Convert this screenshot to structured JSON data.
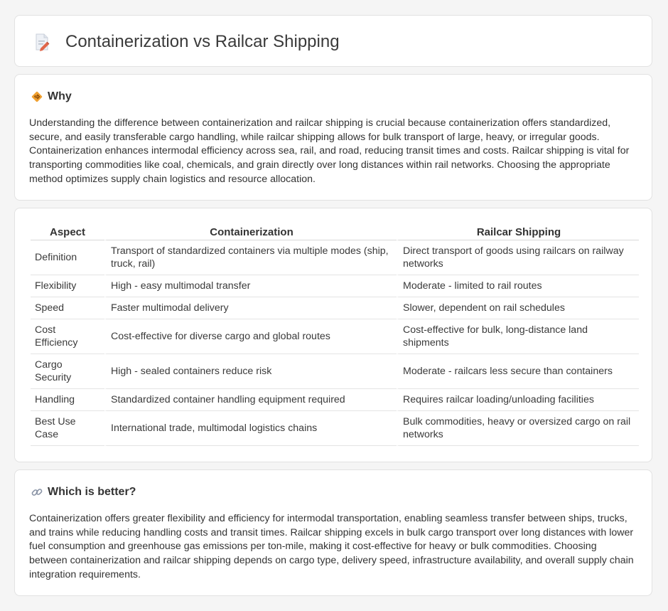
{
  "page": {
    "title": "Containerization vs Railcar Shipping",
    "title_icon": "document-pencil-icon"
  },
  "why": {
    "icon": "diamond-direction-icon",
    "heading": "Why",
    "text": "Understanding the difference between containerization and railcar shipping is crucial because containerization offers standardized, secure, and easily transferable cargo handling, while railcar shipping allows for bulk transport of large, heavy, or irregular goods. Containerization enhances intermodal efficiency across sea, rail, and road, reducing transit times and costs. Railcar shipping is vital for transporting commodities like coal, chemicals, and grain directly over long distances within rail networks. Choosing the appropriate method optimizes supply chain logistics and resource allocation."
  },
  "comparison": {
    "headers": [
      "Aspect",
      "Containerization",
      "Railcar Shipping"
    ],
    "rows": [
      [
        "Definition",
        "Transport of standardized containers via multiple modes (ship, truck, rail)",
        "Direct transport of goods using railcars on railway networks"
      ],
      [
        "Flexibility",
        "High - easy multimodal transfer",
        "Moderate - limited to rail routes"
      ],
      [
        "Speed",
        "Faster multimodal delivery",
        "Slower, dependent on rail schedules"
      ],
      [
        "Cost Efficiency",
        "Cost-effective for diverse cargo and global routes",
        "Cost-effective for bulk, long-distance land shipments"
      ],
      [
        "Cargo Security",
        "High - sealed containers reduce risk",
        "Moderate - railcars less secure than containers"
      ],
      [
        "Handling",
        "Standardized container handling equipment required",
        "Requires railcar loading/unloading facilities"
      ],
      [
        "Best Use Case",
        "International trade, multimodal logistics chains",
        "Bulk commodities, heavy or oversized cargo on rail networks"
      ]
    ]
  },
  "better": {
    "icon": "link-icon",
    "heading": "Which is better?",
    "text": "Containerization offers greater flexibility and efficiency for intermodal transportation, enabling seamless transfer between ships, trucks, and trains while reducing handling costs and transit times. Railcar shipping excels in bulk cargo transport over long distances with lower fuel consumption and greenhouse gas emissions per ton-mile, making it cost-effective for heavy or bulk commodities. Choosing between containerization and railcar shipping depends on cargo type, delivery speed, infrastructure availability, and overall supply chain integration requirements."
  },
  "colors": {
    "background": "#f5f5f5",
    "card": "#ffffff",
    "why_icon": "#f0a030",
    "title_icon": "#e0664a"
  }
}
